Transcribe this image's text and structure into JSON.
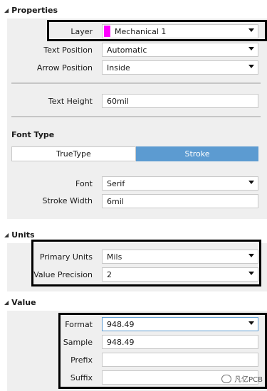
{
  "properties": {
    "header": "Properties",
    "layer": {
      "label": "Layer",
      "value": "Mechanical 1",
      "swatch_color": "#ff00ff"
    },
    "text_position": {
      "label": "Text Position",
      "value": "Automatic"
    },
    "arrow_position": {
      "label": "Arrow Position",
      "value": "Inside"
    },
    "text_height": {
      "label": "Text Height",
      "value": "60mil"
    },
    "font_type": {
      "label": "Font Type",
      "options": [
        "TrueType",
        "Stroke"
      ],
      "selected": "Stroke"
    },
    "font": {
      "label": "Font",
      "value": "Serif"
    },
    "stroke_width": {
      "label": "Stroke Width",
      "value": "6mil"
    }
  },
  "units": {
    "header": "Units",
    "primary_units": {
      "label": "Primary Units",
      "value": "Mils"
    },
    "value_precision": {
      "label": "Value Precision",
      "value": "2"
    }
  },
  "value": {
    "header": "Value",
    "format": {
      "label": "Format",
      "value": "948.49"
    },
    "sample": {
      "label": "Sample",
      "value": "948.49"
    },
    "prefix": {
      "label": "Prefix",
      "value": ""
    },
    "suffix": {
      "label": "Suffix",
      "value": ""
    }
  },
  "watermark": "凡亿PCB",
  "colors": {
    "accent": "#5c9bd1",
    "panel": "#efefef",
    "swatch": "#ff00ff"
  }
}
